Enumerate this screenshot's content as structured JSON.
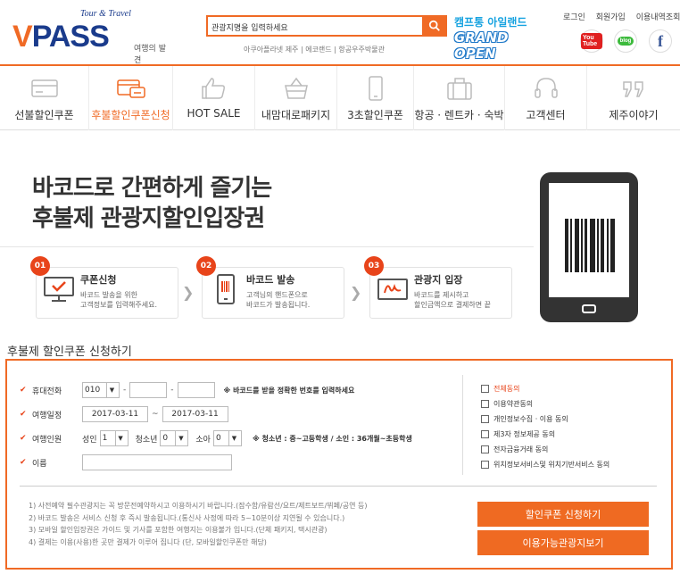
{
  "logo": {
    "main": "PASS",
    "v_letter": "V",
    "tour": "Tour & Travel",
    "sub": "여행의 발견"
  },
  "search": {
    "value": "관광지명을 입력하세요",
    "suggest": "아쿠아플라넷 제주 | 에코랜드 | 항공우주박물관"
  },
  "promo": {
    "line1": "캠프통 아일랜드",
    "line2": "GRAND OPEN"
  },
  "toplinks": [
    "로그인",
    "회원가입",
    "이용내역조회"
  ],
  "social": {
    "youtube": "You Tube",
    "blog": "blog",
    "facebook": "f"
  },
  "nav": [
    {
      "label": "선불할인쿠폰",
      "icon": "card-icon",
      "active": false
    },
    {
      "label": "후불할인쿠폰신청",
      "icon": "card-payment-icon",
      "active": true
    },
    {
      "label": "HOT SALE",
      "icon": "thumbs-up-icon",
      "active": false
    },
    {
      "label": "내맘대로패키지",
      "icon": "basket-icon",
      "active": false
    },
    {
      "label": "3초할인쿠폰",
      "icon": "mobile-icon",
      "active": false
    },
    {
      "label": "항공 · 렌트카 · 숙박",
      "icon": "suitcase-icon",
      "active": false
    },
    {
      "label": "고객센터",
      "icon": "headset-icon",
      "active": false
    },
    {
      "label": "제주이야기",
      "icon": "quote-icon",
      "active": false
    }
  ],
  "hero": {
    "line1": "바코드로 간편하게 즐기는",
    "line2": "후불제 관광지할인입장권"
  },
  "steps": [
    {
      "num": "01",
      "title": "쿠폰신청",
      "desc1": "바코드 발송을 위한",
      "desc2": "고객정보를 입력해주세요."
    },
    {
      "num": "02",
      "title": "바코드 발송",
      "desc1": "고객님의 핸드폰으로",
      "desc2": "바코드가 발송됩니다."
    },
    {
      "num": "03",
      "title": "관광지 입장",
      "desc1": "바코드를 제시하고",
      "desc2": "할인금액으로 결제하면 끝"
    }
  ],
  "chevron": "❯",
  "section_title": "후불제 할인쿠폰 신청하기",
  "form": {
    "check": "✔",
    "phone_label": "휴대전화",
    "phone_prefix": "010",
    "phone_mid": "",
    "phone_last": "",
    "phone_note": "※ 바코드를 받을 정확한 번호를 입력하세요",
    "date_label": "여행일정",
    "date_from": "2017-03-11",
    "date_to": "2017-03-11",
    "people_label": "여행인원",
    "adult_label": "성인",
    "adult_value": "1",
    "youth_label": "청소년",
    "youth_value": "0",
    "child_label": "소아",
    "child_value": "0",
    "people_note": "※ 청소년 : 중~고등학생 / 소인 : 36개월~초등학생",
    "name_label": "이름",
    "name_value": "",
    "dash": "-",
    "tilde": "~"
  },
  "agreements": [
    "전체동의",
    "이용약관동의",
    "개인정보수집 · 이용 동의",
    "제3자 정보제공 동의",
    "전자금융거래 동의",
    "위치정보서비스및 위치기반서비스 동의"
  ],
  "notices": [
    "1) 사전예약 필수관광지는 꼭 방문전예약하시고 이용하시기 바랍니다.(잠수함/유람선/요트/제트보트/뷔페/공연 등)",
    "2) 바코드 발송은 서비스 신청 후 즉시 발송됩니다.(통신사 사정에 따라 5~10분이상 지연될 수 있습니다.)",
    "3) 모바일 할인입장권은 가이드 및 기사를 포함한 여행지는 이용불가 입니다.(단체 패키지, 택시관광)",
    "4) 결제는 이용(사용)한 곳만 결제가 이루어 집니다 (단, 모바일할인쿠폰만 해당)"
  ],
  "buttons": {
    "apply": "할인쿠폰 신청하기",
    "view": "이용가능관광지보기"
  },
  "colors": {
    "accent": "#f06a25",
    "brand_blue": "#1a3b8c",
    "step_red": "#e8441a"
  }
}
